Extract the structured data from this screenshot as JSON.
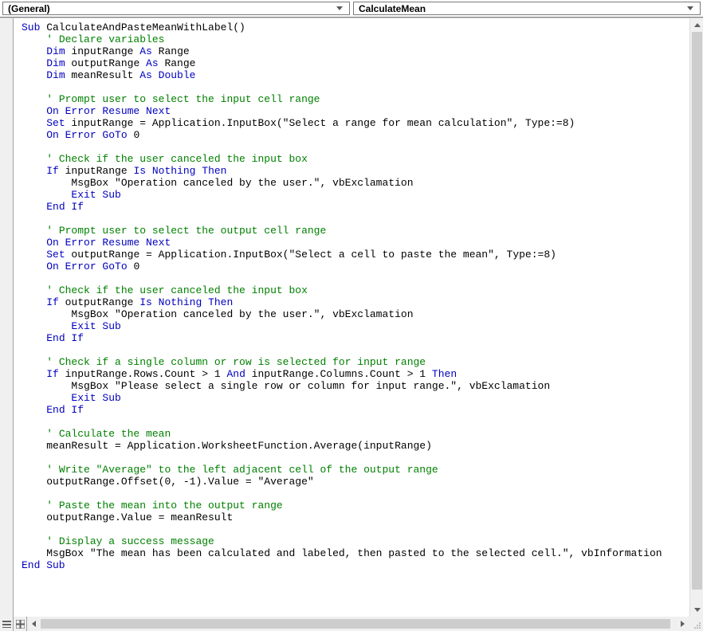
{
  "dropdowns": {
    "left": "(General)",
    "right": "CalculateMean"
  },
  "code": {
    "lines": [
      {
        "indent": 0,
        "segments": [
          {
            "t": "kw",
            "v": "Sub"
          },
          {
            "t": "tx",
            "v": " CalculateAndPasteMeanWithLabel()"
          }
        ]
      },
      {
        "indent": 1,
        "segments": [
          {
            "t": "cm",
            "v": "' Declare variables"
          }
        ]
      },
      {
        "indent": 1,
        "segments": [
          {
            "t": "kw",
            "v": "Dim"
          },
          {
            "t": "tx",
            "v": " inputRange "
          },
          {
            "t": "kw",
            "v": "As"
          },
          {
            "t": "tx",
            "v": " Range"
          }
        ]
      },
      {
        "indent": 1,
        "segments": [
          {
            "t": "kw",
            "v": "Dim"
          },
          {
            "t": "tx",
            "v": " outputRange "
          },
          {
            "t": "kw",
            "v": "As"
          },
          {
            "t": "tx",
            "v": " Range"
          }
        ]
      },
      {
        "indent": 1,
        "segments": [
          {
            "t": "kw",
            "v": "Dim"
          },
          {
            "t": "tx",
            "v": " meanResult "
          },
          {
            "t": "kw",
            "v": "As Double"
          }
        ]
      },
      {
        "indent": 1,
        "segments": []
      },
      {
        "indent": 1,
        "segments": [
          {
            "t": "cm",
            "v": "' Prompt user to select the input cell range"
          }
        ]
      },
      {
        "indent": 1,
        "segments": [
          {
            "t": "kw",
            "v": "On Error Resume Next"
          }
        ]
      },
      {
        "indent": 1,
        "segments": [
          {
            "t": "kw",
            "v": "Set"
          },
          {
            "t": "tx",
            "v": " inputRange = Application.InputBox(\"Select a range for mean calculation\", Type:=8)"
          }
        ]
      },
      {
        "indent": 1,
        "segments": [
          {
            "t": "kw",
            "v": "On Error GoTo"
          },
          {
            "t": "tx",
            "v": " 0"
          }
        ]
      },
      {
        "indent": 1,
        "segments": []
      },
      {
        "indent": 1,
        "segments": [
          {
            "t": "cm",
            "v": "' Check if the user canceled the input box"
          }
        ]
      },
      {
        "indent": 1,
        "segments": [
          {
            "t": "kw",
            "v": "If"
          },
          {
            "t": "tx",
            "v": " inputRange "
          },
          {
            "t": "kw",
            "v": "Is Nothing Then"
          }
        ]
      },
      {
        "indent": 2,
        "segments": [
          {
            "t": "tx",
            "v": "MsgBox \"Operation canceled by the user.\", vbExclamation"
          }
        ]
      },
      {
        "indent": 2,
        "segments": [
          {
            "t": "kw",
            "v": "Exit Sub"
          }
        ]
      },
      {
        "indent": 1,
        "segments": [
          {
            "t": "kw",
            "v": "End If"
          }
        ]
      },
      {
        "indent": 1,
        "segments": []
      },
      {
        "indent": 1,
        "segments": [
          {
            "t": "cm",
            "v": "' Prompt user to select the output cell range"
          }
        ]
      },
      {
        "indent": 1,
        "segments": [
          {
            "t": "kw",
            "v": "On Error Resume Next"
          }
        ]
      },
      {
        "indent": 1,
        "segments": [
          {
            "t": "kw",
            "v": "Set"
          },
          {
            "t": "tx",
            "v": " outputRange = Application.InputBox(\"Select a cell to paste the mean\", Type:=8)"
          }
        ]
      },
      {
        "indent": 1,
        "segments": [
          {
            "t": "kw",
            "v": "On Error GoTo"
          },
          {
            "t": "tx",
            "v": " 0"
          }
        ]
      },
      {
        "indent": 1,
        "segments": []
      },
      {
        "indent": 1,
        "segments": [
          {
            "t": "cm",
            "v": "' Check if the user canceled the input box"
          }
        ]
      },
      {
        "indent": 1,
        "segments": [
          {
            "t": "kw",
            "v": "If"
          },
          {
            "t": "tx",
            "v": " outputRange "
          },
          {
            "t": "kw",
            "v": "Is Nothing Then"
          }
        ]
      },
      {
        "indent": 2,
        "segments": [
          {
            "t": "tx",
            "v": "MsgBox \"Operation canceled by the user.\", vbExclamation"
          }
        ]
      },
      {
        "indent": 2,
        "segments": [
          {
            "t": "kw",
            "v": "Exit Sub"
          }
        ]
      },
      {
        "indent": 1,
        "segments": [
          {
            "t": "kw",
            "v": "End If"
          }
        ]
      },
      {
        "indent": 1,
        "segments": []
      },
      {
        "indent": 1,
        "segments": [
          {
            "t": "cm",
            "v": "' Check if a single column or row is selected for input range"
          }
        ]
      },
      {
        "indent": 1,
        "segments": [
          {
            "t": "kw",
            "v": "If"
          },
          {
            "t": "tx",
            "v": " inputRange.Rows.Count > 1 "
          },
          {
            "t": "kw",
            "v": "And"
          },
          {
            "t": "tx",
            "v": " inputRange.Columns.Count > 1 "
          },
          {
            "t": "kw",
            "v": "Then"
          }
        ]
      },
      {
        "indent": 2,
        "segments": [
          {
            "t": "tx",
            "v": "MsgBox \"Please select a single row or column for input range.\", vbExclamation"
          }
        ]
      },
      {
        "indent": 2,
        "segments": [
          {
            "t": "kw",
            "v": "Exit Sub"
          }
        ]
      },
      {
        "indent": 1,
        "segments": [
          {
            "t": "kw",
            "v": "End If"
          }
        ]
      },
      {
        "indent": 1,
        "segments": []
      },
      {
        "indent": 1,
        "segments": [
          {
            "t": "cm",
            "v": "' Calculate the mean"
          }
        ]
      },
      {
        "indent": 1,
        "segments": [
          {
            "t": "tx",
            "v": "meanResult = Application.WorksheetFunction.Average(inputRange)"
          }
        ]
      },
      {
        "indent": 1,
        "segments": []
      },
      {
        "indent": 1,
        "segments": [
          {
            "t": "cm",
            "v": "' Write \"Average\" to the left adjacent cell of the output range"
          }
        ]
      },
      {
        "indent": 1,
        "segments": [
          {
            "t": "tx",
            "v": "outputRange.Offset(0, -1).Value = \"Average\""
          }
        ]
      },
      {
        "indent": 1,
        "segments": []
      },
      {
        "indent": 1,
        "segments": [
          {
            "t": "cm",
            "v": "' Paste the mean into the output range"
          }
        ]
      },
      {
        "indent": 1,
        "segments": [
          {
            "t": "tx",
            "v": "outputRange.Value = meanResult"
          }
        ]
      },
      {
        "indent": 1,
        "segments": []
      },
      {
        "indent": 1,
        "segments": [
          {
            "t": "cm",
            "v": "' Display a success message"
          }
        ]
      },
      {
        "indent": 1,
        "segments": [
          {
            "t": "tx",
            "v": "MsgBox \"The mean has been calculated and labeled, then pasted to the selected cell.\", vbInformation"
          }
        ]
      },
      {
        "indent": 0,
        "segments": [
          {
            "t": "kw",
            "v": "End Sub"
          }
        ]
      }
    ]
  }
}
